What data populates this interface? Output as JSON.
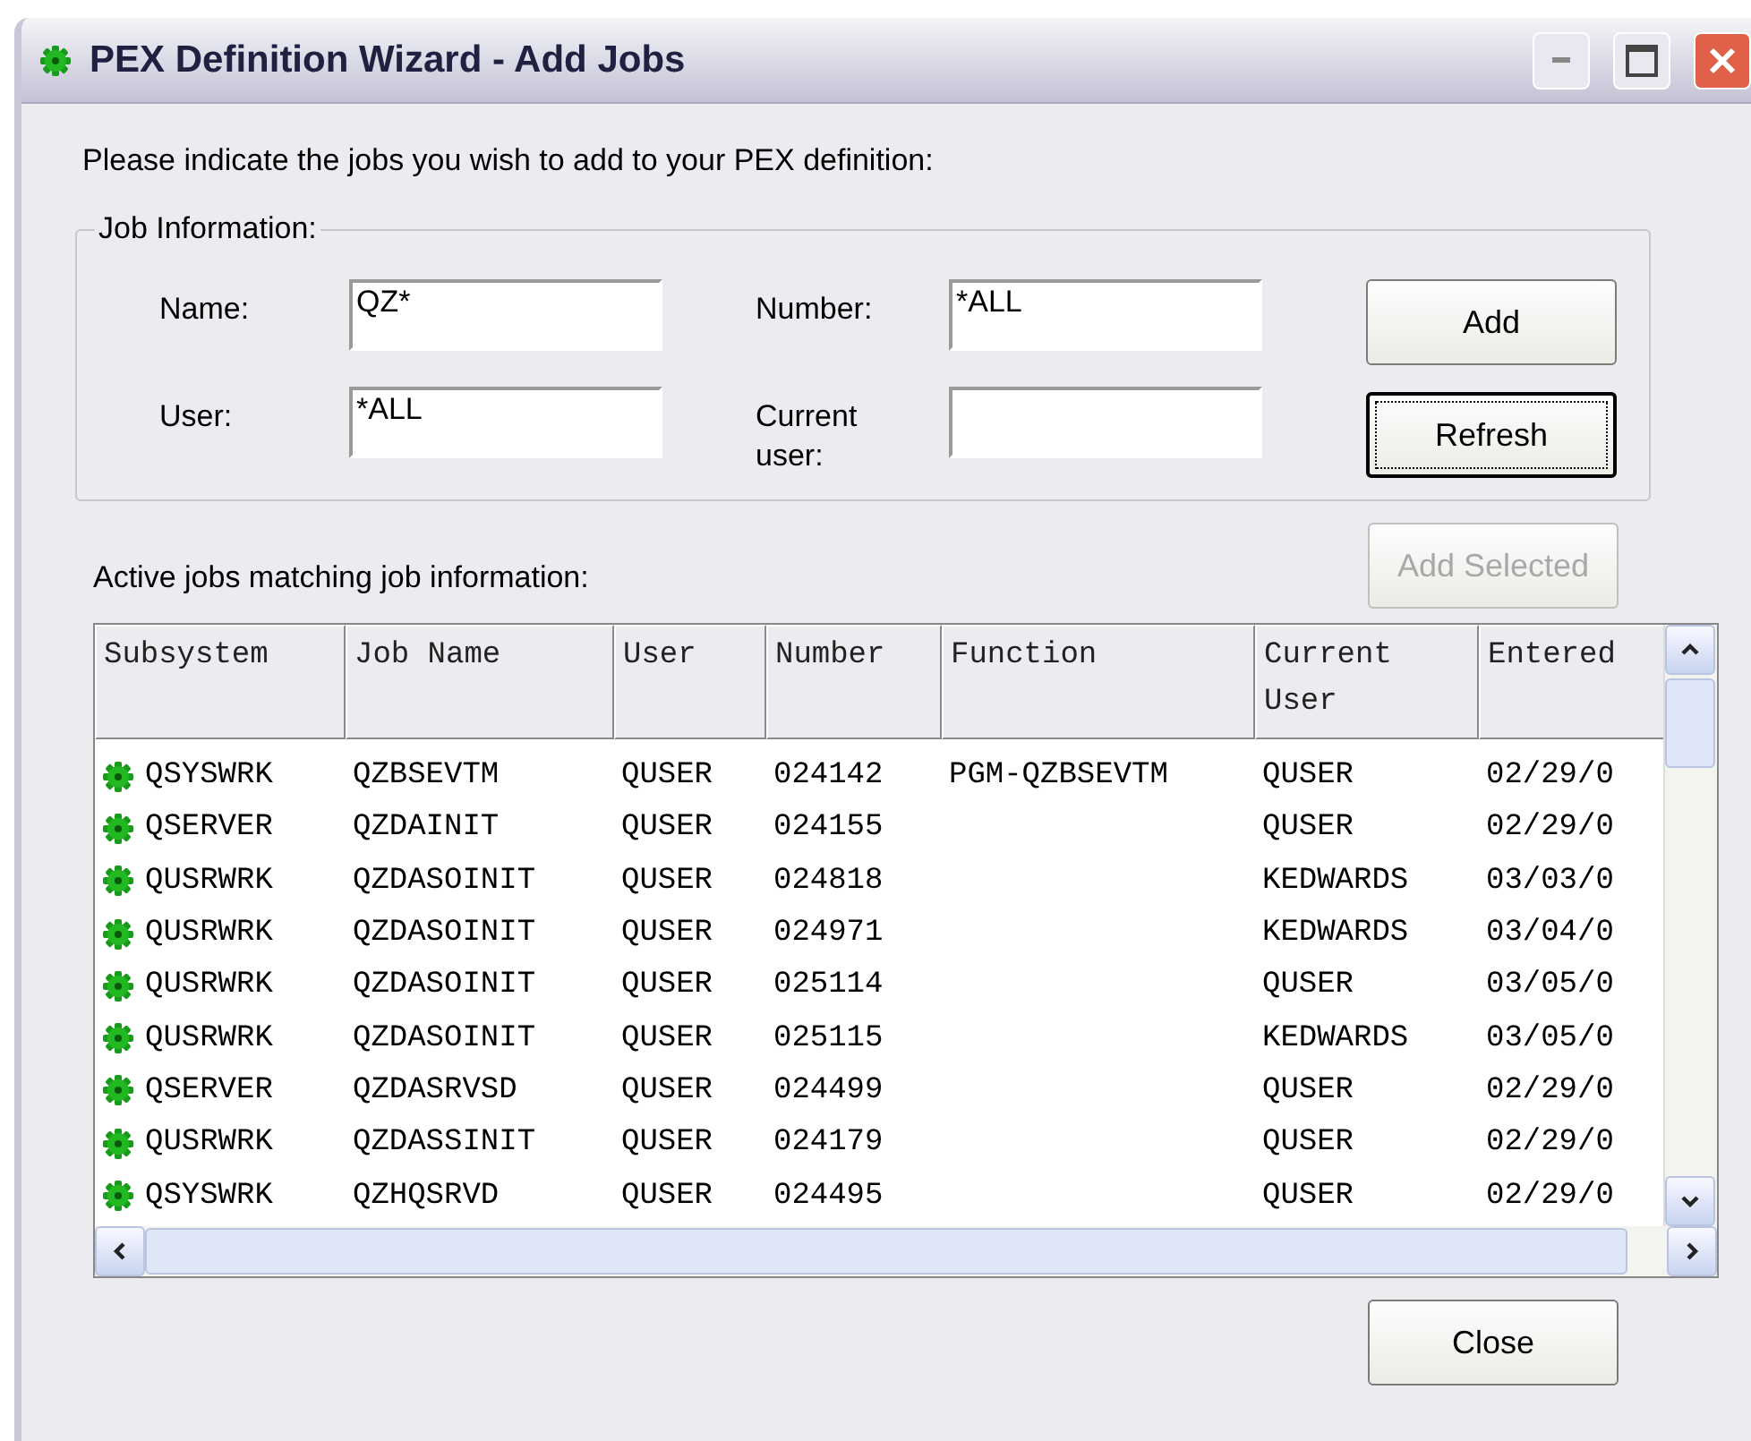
{
  "window": {
    "title": "PEX Definition Wizard - Add Jobs"
  },
  "intro": "Please indicate the jobs you wish to add to your PEX definition:",
  "job_information": {
    "title": "Job Information:",
    "fields": [
      {
        "label": "Name:",
        "value": "QZ*"
      },
      {
        "label": "Number:",
        "value": "*ALL"
      },
      {
        "label": "User:",
        "value": "*ALL"
      },
      {
        "label": "Current user:"
      }
    ],
    "buttons": [
      {
        "label": "Add",
        "default": false
      },
      {
        "label": "Refresh",
        "default": true
      }
    ]
  },
  "active_jobs_label": "Active jobs matching job information:",
  "add_selected": {
    "label": "Add Selected",
    "disabled": true
  },
  "table": {
    "columns": [
      "Subsystem",
      "Job Name",
      "User",
      "Number",
      "Function",
      "Current User",
      "Entered"
    ],
    "rows": [
      [
        "QSYSWRK",
        "QZBSEVTM",
        "QUSER",
        "024142",
        "PGM-QZBSEVTM",
        "QUSER",
        "02/29/0"
      ],
      [
        "QSERVER",
        "QZDAINIT",
        "QUSER",
        "024155",
        "",
        "QUSER",
        "02/29/0"
      ],
      [
        "QUSRWRK",
        "QZDASOINIT",
        "QUSER",
        "024818",
        "",
        "KEDWARDS",
        "03/03/0"
      ],
      [
        "QUSRWRK",
        "QZDASOINIT",
        "QUSER",
        "024971",
        "",
        "KEDWARDS",
        "03/04/0"
      ],
      [
        "QUSRWRK",
        "QZDASOINIT",
        "QUSER",
        "025114",
        "",
        "QUSER",
        "03/05/0"
      ],
      [
        "QUSRWRK",
        "QZDASOINIT",
        "QUSER",
        "025115",
        "",
        "KEDWARDS",
        "03/05/0"
      ],
      [
        "QSERVER",
        "QZDASRVSD",
        "QUSER",
        "024499",
        "",
        "QUSER",
        "02/29/0"
      ],
      [
        "QUSRWRK",
        "QZDASSINIT",
        "QUSER",
        "024179",
        "",
        "QUSER",
        "02/29/0"
      ],
      [
        "QSYSWRK",
        "QZHQSRVD",
        "QUSER",
        "024495",
        "",
        "QUSER",
        "02/29/0"
      ]
    ]
  },
  "close_button": "Close"
}
